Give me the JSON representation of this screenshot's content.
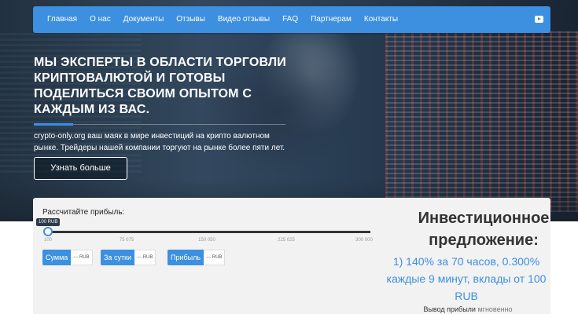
{
  "nav": {
    "items": [
      "Главная",
      "О нас",
      "Документы",
      "Отзывы",
      "Видео отзывы",
      "FAQ",
      "Партнерам",
      "Контакты"
    ],
    "social_icon": "youtube-icon"
  },
  "hero": {
    "headline_parts": [
      {
        "text": "МЫ ",
        "bold": false
      },
      {
        "text": "ЭКСПЕРТЫ",
        "bold": true
      },
      {
        "text": " В ОБЛАСТИ ",
        "bold": false
      },
      {
        "text": "ТОРГОВЛИ КРИПТОВАЛЮТОЙ",
        "bold": true
      },
      {
        "text": " И ГОТОВЫ ПОДЕЛИТЬСЯ СВОИМ ОПЫТОМ С КАЖДЫМ ИЗ ВАС.",
        "bold": false
      }
    ],
    "subtext": "crypto-only.org ваш маяк в мире инвестиций на крипто валютном рынке. Трейдеры нашей компании торгуют на рынке более пяти лет.",
    "button_label": "Узнать больше"
  },
  "calculator": {
    "title": "Рассчитайте прибыль:",
    "slider_tooltip": "100 RUB",
    "slider_value_fraction": 0.0,
    "ticks": [
      "100",
      "75 075",
      "150 050",
      "225 025",
      "300 000"
    ],
    "results": [
      {
        "label": "Сумма",
        "value": "--- RUB"
      },
      {
        "label": "За сутки",
        "value": "--- RUB"
      },
      {
        "label": "Прибыль",
        "value": "--- RUB"
      }
    ]
  },
  "offer": {
    "title": "Инвестиционное предложение:",
    "text": "1) 140% за 70 часов, 0.300% каждые 9 минут, вклады от 100 RUB",
    "footer_label": "Вывод прибыли",
    "footer_value": "мгновенно"
  },
  "colors": {
    "accent": "#3d8fe0",
    "hero_dark": "#223140"
  }
}
